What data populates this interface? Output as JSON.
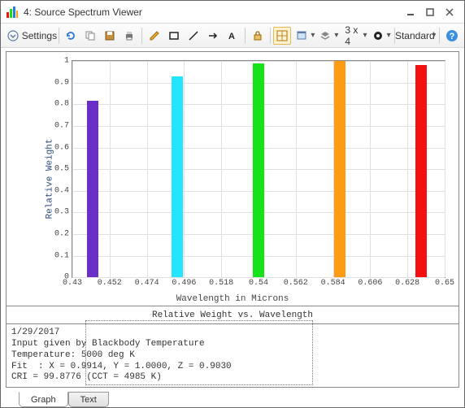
{
  "window": {
    "title": "4: Source Spectrum Viewer"
  },
  "toolbar": {
    "settings_label": "Settings",
    "grid_label": "3 x 4",
    "style_label": "Standard"
  },
  "chart_data": {
    "type": "bar",
    "xlabel": "Wavelength in Microns",
    "ylabel": "Relative Weight",
    "subtitle": "Relative Weight vs. Wavelength",
    "ylim": [
      0,
      1
    ],
    "xlim": [
      0.43,
      0.65
    ],
    "yticks": [
      0,
      0.1,
      0.2,
      0.3,
      0.4,
      0.5,
      0.6,
      0.7,
      0.8,
      0.9,
      1
    ],
    "xticks": [
      0.43,
      0.452,
      0.474,
      0.496,
      0.518,
      0.54,
      0.562,
      0.584,
      0.606,
      0.628,
      0.65
    ],
    "series": [
      {
        "x": 0.442,
        "y": 0.815,
        "color": "purple"
      },
      {
        "x": 0.492,
        "y": 0.93,
        "color": "cyan"
      },
      {
        "x": 0.54,
        "y": 0.99,
        "color": "green"
      },
      {
        "x": 0.588,
        "y": 1.0,
        "color": "orange"
      },
      {
        "x": 0.636,
        "y": 0.98,
        "color": "red"
      }
    ]
  },
  "info": {
    "line1": "1/29/2017",
    "line2": "Input given by Blackbody Temperature",
    "line3": "Temperature: 5000 deg K",
    "line4": "Fit  : X = 0.9914, Y = 1.0000, Z = 0.9030",
    "line5": "CRI = 99.8776 (CCT = 4985 K)"
  },
  "tabs": {
    "graph": "Graph",
    "text": "Text"
  }
}
